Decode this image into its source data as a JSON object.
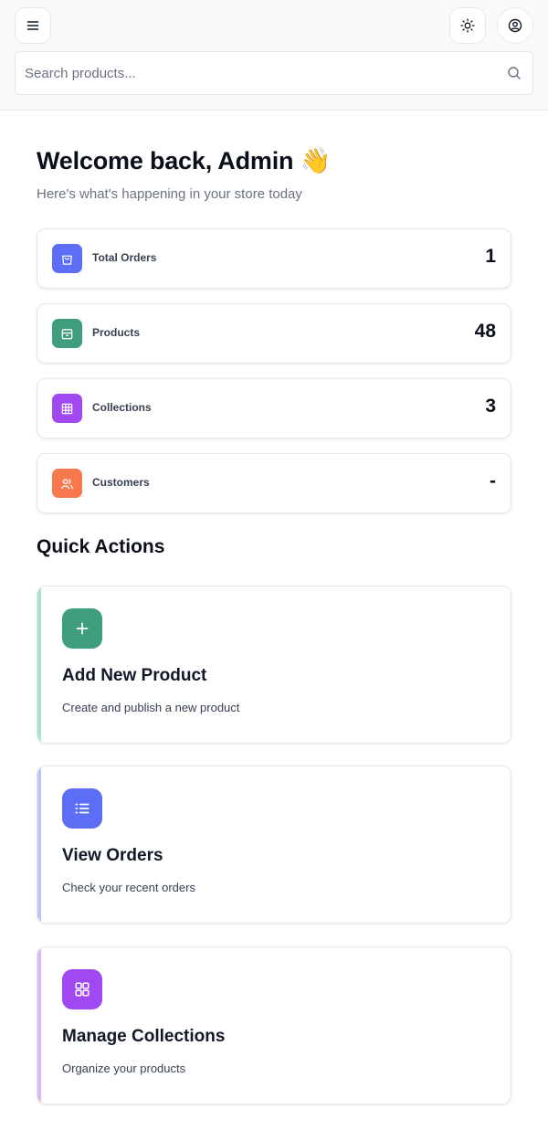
{
  "header": {
    "menu_icon": "menu-icon",
    "theme_icon": "sun-icon",
    "user_icon": "user-circle-icon"
  },
  "search": {
    "placeholder": "Search products...",
    "value": "",
    "icon": "search-icon"
  },
  "welcome": {
    "title": "Welcome back, Admin 👋",
    "subtitle": "Here's what's happening in your store today"
  },
  "stats": [
    {
      "label": "Total Orders",
      "value": "1",
      "icon": "shopping-bag-icon",
      "color": "#5b6ef5"
    },
    {
      "label": "Products",
      "value": "48",
      "icon": "package-icon",
      "color": "#3f9e7c"
    },
    {
      "label": "Collections",
      "value": "3",
      "icon": "grid-icon",
      "color": "#a149f0"
    },
    {
      "label": "Customers",
      "value": "-",
      "icon": "users-icon",
      "color": "#f7774f"
    }
  ],
  "quick_actions": {
    "title": "Quick Actions",
    "items": [
      {
        "title": "Add New Product",
        "description": "Create and publish a new product",
        "icon": "plus-icon",
        "color": "#3f9e7c",
        "accent": "#a7e5cb"
      },
      {
        "title": "View Orders",
        "description": "Check your recent orders",
        "icon": "list-icon",
        "color": "#5b6ef5",
        "accent": "#b9c4fb"
      },
      {
        "title": "Manage Collections",
        "description": "Organize your products",
        "icon": "layout-grid-icon",
        "color": "#a149f0",
        "accent": "#dcb6f7"
      }
    ]
  }
}
